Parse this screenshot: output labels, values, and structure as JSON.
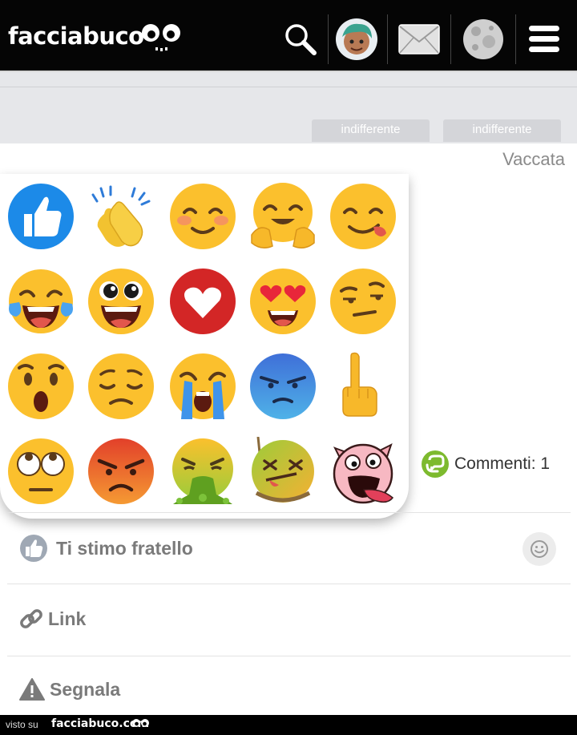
{
  "header": {
    "logo_text": "facciabuco",
    "icons": [
      "search-icon",
      "avatar-icon",
      "mail-icon",
      "moon-icon",
      "menu-icon"
    ]
  },
  "tabs": [
    {
      "label": "indifferente"
    },
    {
      "label": "indifferente"
    }
  ],
  "post": {
    "title_partial": "Vaccata"
  },
  "reactions": [
    "thumbs-up-icon",
    "clapping-hands-icon",
    "smiling-face-icon",
    "hugging-face-icon",
    "yum-face-icon",
    "tears-of-joy-icon",
    "grinning-big-eyes-icon",
    "heart-icon",
    "heart-eyes-icon",
    "raised-eyebrow-icon",
    "surprised-face-icon",
    "pensive-face-icon",
    "crying-face-icon",
    "angry-blue-face-icon",
    "middle-finger-icon",
    "rolling-eyes-icon",
    "angry-red-face-icon",
    "vomiting-face-icon",
    "hanged-face-icon",
    "pig-face-icon"
  ],
  "comments": {
    "label": "Commenti: 1"
  },
  "actions": {
    "like_label": "Ti stimo fratello",
    "link_label": "Link",
    "report_label": "Segnala"
  },
  "footer": {
    "visto_su": "visto su",
    "site": "facciabuco.com"
  }
}
